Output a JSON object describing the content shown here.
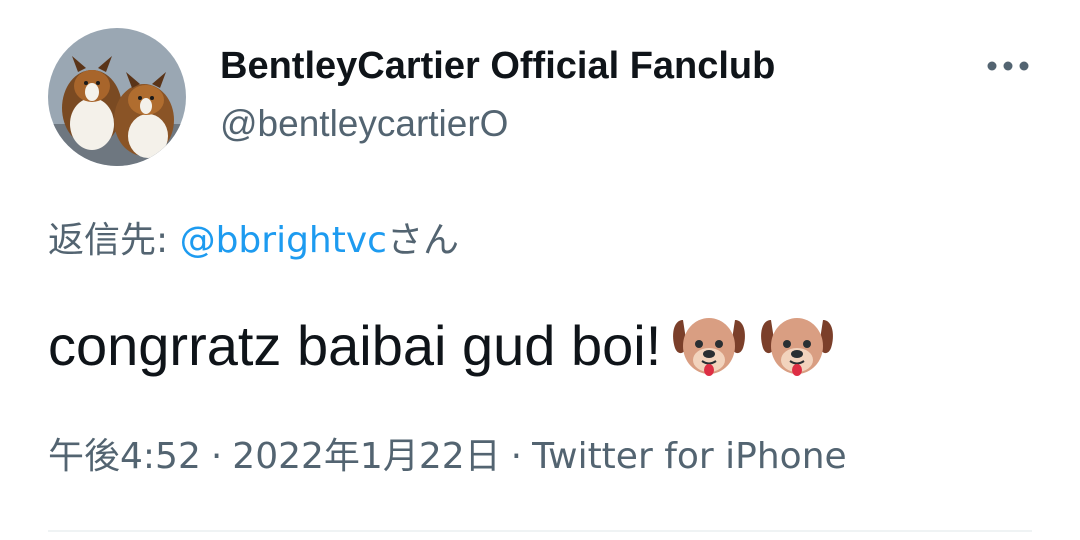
{
  "tweet": {
    "display_name": "BentleyCartier Official Fanclub",
    "handle": "@bentleycartierO",
    "reply_prefix": "返信先: ",
    "reply_to": "@bbrightvc",
    "reply_suffix": "さん",
    "text": "congrratz baibai gud boi!",
    "emojis": [
      "dog-face",
      "dog-face"
    ],
    "time": "午後4:52",
    "date": "2022年1月22日",
    "separator": "·",
    "source": "Twitter for iPhone"
  },
  "icons": {
    "more": "more-horizontal-icon"
  },
  "colors": {
    "text": "#0f1419",
    "secondary": "#536471",
    "link": "#1d9bf0",
    "divider": "#eff3f4"
  }
}
